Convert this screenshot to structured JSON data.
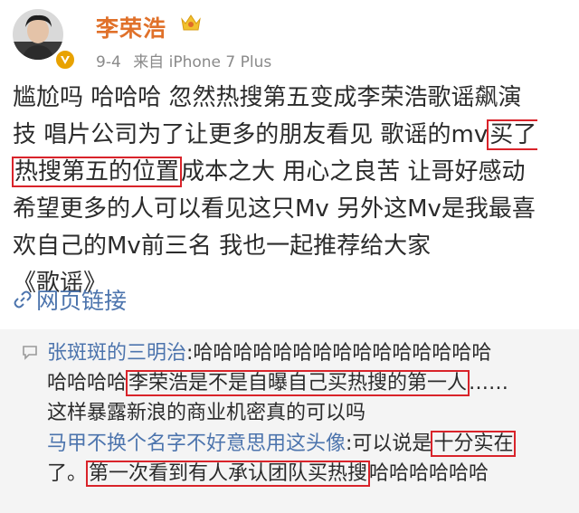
{
  "header": {
    "username": "李荣浩",
    "date": "9-4",
    "source_prefix": "来自",
    "device": "iPhone 7 Plus",
    "name_color": "#e0712a",
    "badge_icon": "crown-icon",
    "verified_icon": "verified-v-icon"
  },
  "post": {
    "line1": "尴尬吗 哈哈哈 忽然热搜第五变成李荣浩歌谣飙演",
    "line2_a": "技 唱片公司为了让更多的朋友看见 歌谣的mv",
    "line2_hl": "买了",
    "line3_hl": "热搜第五的位置",
    "line3_b": "成本之大 用心之良苦 让哥好感动",
    "line4": "希望更多的人可以看见这只Mv 另外这Mv是我最喜",
    "line5": "欢自己的Mv前三名 我也一起推荐给大家",
    "line6": "《歌谣》",
    "weblink_icon": "link-icon",
    "weblink": "网页链接"
  },
  "comments": {
    "quote_icon": "quote-icon",
    "c1": {
      "name": "张斑斑的三明治",
      "l1_text": ":哈哈哈哈哈哈哈哈哈哈哈哈哈哈哈",
      "l2_a": "哈哈哈哈",
      "l2_hl": "李荣浩是不是自曝自己买热搜的第一人",
      "l2_b": "……",
      "l3": "这样暴露新浪的商业机密真的可以吗"
    },
    "c2": {
      "name": "马甲不换个名字不好意思用这头像",
      "l1_text": ":可以说是",
      "l1_hl": "十分实在",
      "l2_a": "了。",
      "l2_hl": "第一次看到有人承认团队买热搜",
      "l2_b": "哈哈哈哈哈哈"
    }
  },
  "colors": {
    "highlight_border": "#d9232a",
    "link": "#4c74ad",
    "comment_bg": "#f4f4f4"
  }
}
